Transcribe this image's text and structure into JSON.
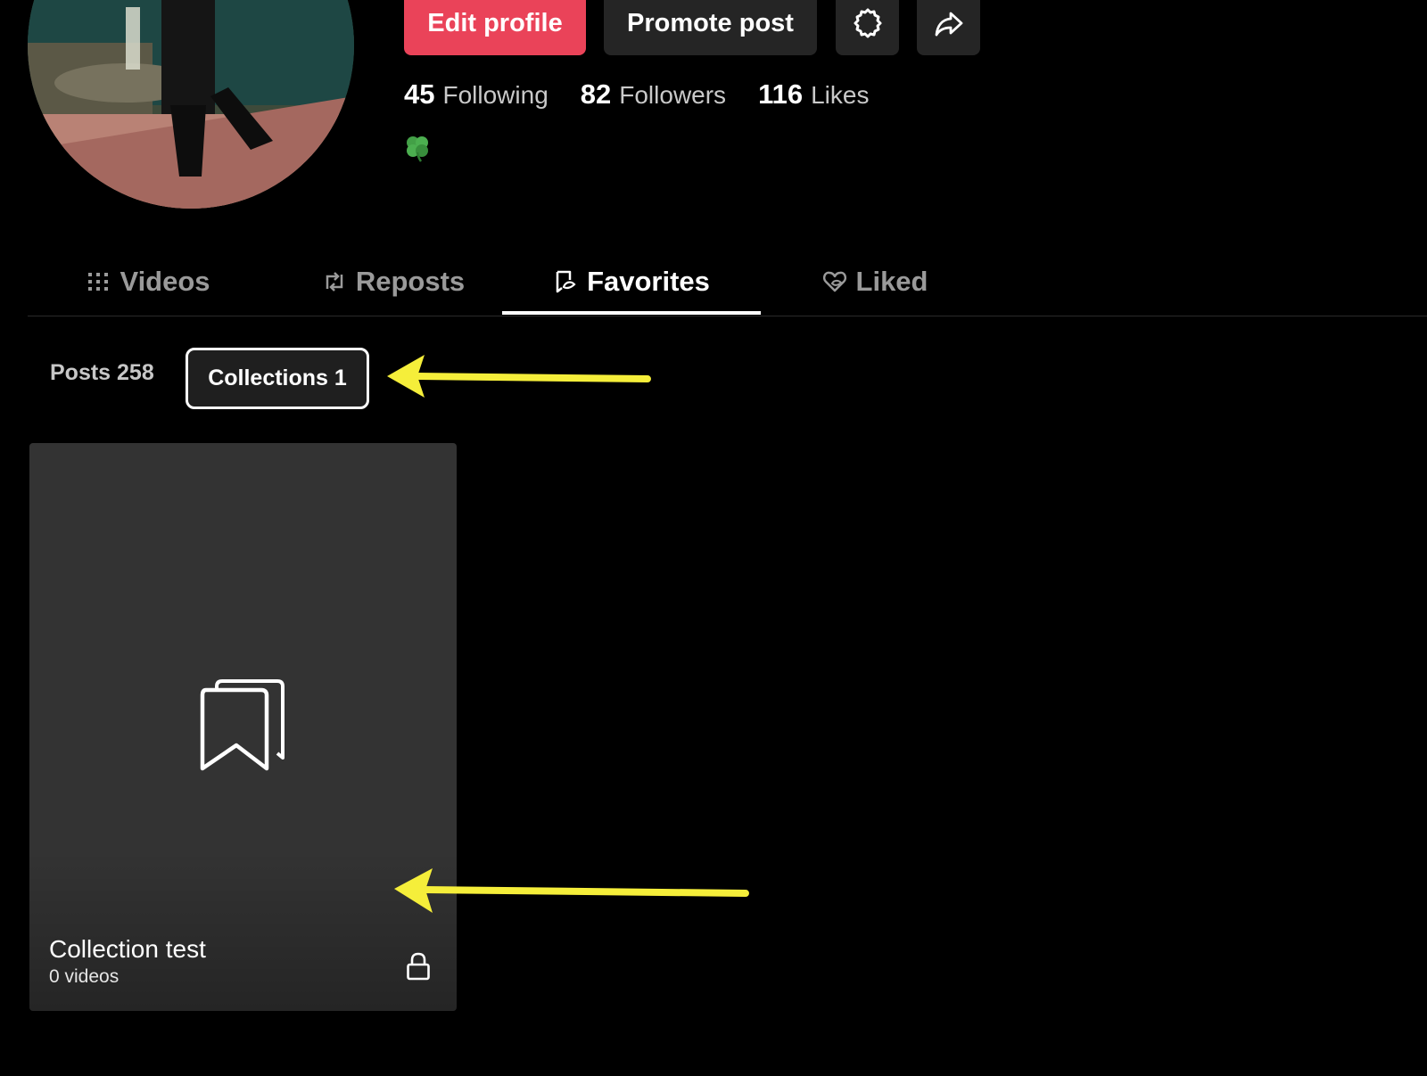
{
  "profile": {
    "actions": {
      "edit_label": "Edit profile",
      "promote_label": "Promote post",
      "settings_icon": "settings-gear-icon",
      "share_icon": "share-arrow-icon"
    },
    "stats": [
      {
        "number": "45",
        "label": "Following"
      },
      {
        "number": "82",
        "label": "Followers"
      },
      {
        "number": "116",
        "label": "Likes"
      }
    ],
    "bio_icon": "four-leaf-clover-icon"
  },
  "tabs": [
    {
      "label": "Videos",
      "icon": "grid-icon",
      "active": false
    },
    {
      "label": "Reposts",
      "icon": "repost-icon",
      "active": false
    },
    {
      "label": "Favorites",
      "icon": "bookmark-icon",
      "active": true
    },
    {
      "label": "Liked",
      "icon": "heart-icon",
      "active": false
    }
  ],
  "subtabs": {
    "posts_label": "Posts 258",
    "collections_label": "Collections 1",
    "selected": "collections"
  },
  "collections": [
    {
      "title": "Collection test",
      "count": "0 videos",
      "private": true
    }
  ],
  "colors": {
    "accent": "#ea4359",
    "background": "#000000",
    "card": "#333333",
    "annotation_arrow": "#f5ee3a"
  }
}
